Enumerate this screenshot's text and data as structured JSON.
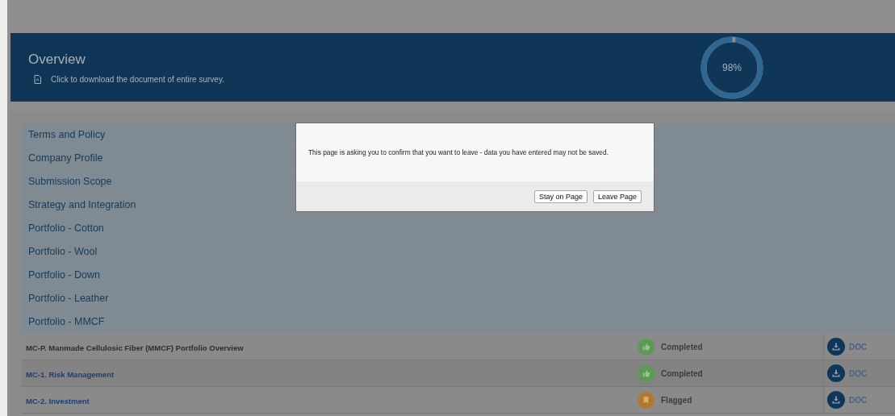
{
  "overview": {
    "title": "Overview",
    "download_text": "Click to download the document of entire survey.",
    "progress": {
      "level": 0.98,
      "reading": "98%"
    }
  },
  "sections": [
    "Terms and Policy",
    "Company Profile",
    "Submission Scope",
    "Strategy and Integration",
    "Portfolio - Cotton",
    "Portfolio - Wool",
    "Portfolio - Down",
    "Portfolio - Leather",
    "Portfolio - MMCF"
  ],
  "items": [
    {
      "title": "MC-P. Manmade Cellulosic Fiber (MMCF) Portfolio Overview",
      "link": false,
      "status": {
        "kind": "completed",
        "label": "Completed"
      },
      "doc": "DOC"
    },
    {
      "title": "MC-1. Risk Management",
      "link": true,
      "status": {
        "kind": "completed",
        "label": "Completed"
      },
      "doc": "DOC"
    },
    {
      "title": "MC-2. Investment",
      "link": true,
      "status": {
        "kind": "flagged",
        "label": "Flagged"
      },
      "doc": "DOC"
    }
  ],
  "dialog": {
    "message": "This page is asking you to confirm that you want to leave - data you have entered may not be saved.",
    "buttons": [
      "Stay on Page",
      "Leave Page"
    ]
  }
}
